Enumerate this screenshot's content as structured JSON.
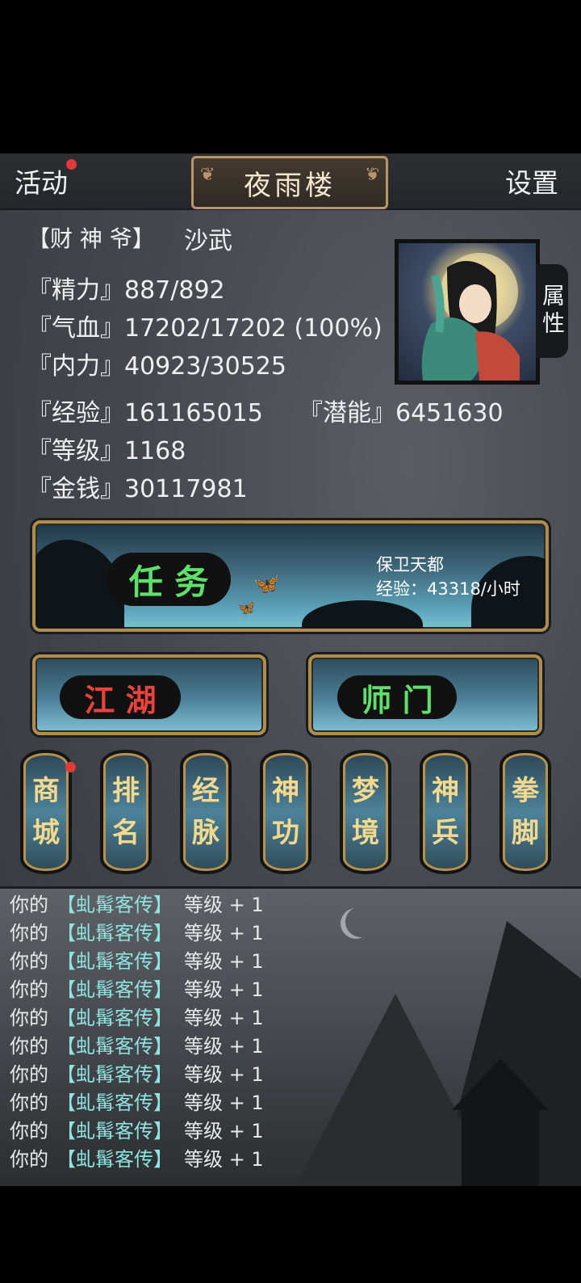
{
  "topbar": {
    "left": "活动",
    "title": "夜雨楼",
    "right": "设置"
  },
  "profile": {
    "title": "【财 神 爷】",
    "name": "沙武",
    "stats": {
      "energy": "『精力』887/892",
      "blood": "『气血』17202/17202 (100%)",
      "inner": "『内力』40923/30525",
      "exp": "『经验』161165015",
      "potential": "『潜能』6451630",
      "level": "『等级』1168",
      "money": "『金钱』30117981"
    },
    "attr_tab": "属性"
  },
  "quest": {
    "label": "任 务",
    "name": "保卫天都",
    "rate": "经验：43318/小时"
  },
  "buttons": {
    "jianghu": "江 湖",
    "shimen": "师 门"
  },
  "tabs": [
    {
      "top": "商",
      "bottom": "城"
    },
    {
      "top": "排",
      "bottom": "名"
    },
    {
      "top": "经",
      "bottom": "脉"
    },
    {
      "top": "神",
      "bottom": "功"
    },
    {
      "top": "梦",
      "bottom": "境"
    },
    {
      "top": "神",
      "bottom": "兵"
    },
    {
      "top": "拳",
      "bottom": "脚"
    }
  ],
  "log": [
    {
      "a": "你的",
      "b": "【虬髯客传】",
      "c": "等级 + 1"
    },
    {
      "a": "你的",
      "b": "【虬髯客传】",
      "c": "等级 + 1"
    },
    {
      "a": "你的",
      "b": "【虬髯客传】",
      "c": "等级 + 1"
    },
    {
      "a": "你的",
      "b": "【虬髯客传】",
      "c": "等级 + 1"
    },
    {
      "a": "你的",
      "b": "【虬髯客传】",
      "c": "等级 + 1"
    },
    {
      "a": "你的",
      "b": "【虬髯客传】",
      "c": "等级 + 1"
    },
    {
      "a": "你的",
      "b": "【虬髯客传】",
      "c": "等级 + 1"
    },
    {
      "a": "你的",
      "b": "【虬髯客传】",
      "c": "等级 + 1"
    },
    {
      "a": "你的",
      "b": "【虬髯客传】",
      "c": "等级 + 1"
    },
    {
      "a": "你的",
      "b": "【虬髯客传】",
      "c": "等级 + 1"
    }
  ],
  "colors": {
    "quest_label": "#5fe06a",
    "jianghu_label": "#e8433d",
    "shimen_label": "#5fe06a",
    "log_item": "#8fe3e1",
    "frame_gold": "#b08d4a"
  }
}
